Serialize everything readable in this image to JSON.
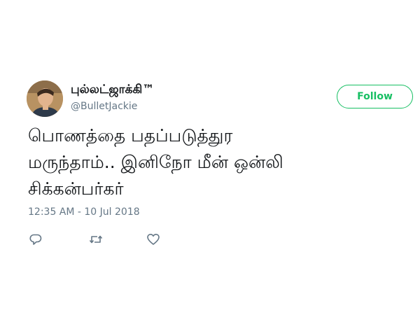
{
  "tweet": {
    "display_name": "புல்லட்ஜாக்கி™",
    "handle": "@BulletJackie",
    "follow_label": "Follow",
    "text_lines": [
      "பொணத்தை பதப்படுத்துர",
      "மருந்தாம்.. இனிநோ மீன்  ஒன்லி",
      "சிக்கன்பர்கர்"
    ],
    "timestamp": "12:35 AM - 10 Jul 2018"
  },
  "icons": {
    "reply": "reply-icon",
    "retweet": "retweet-icon",
    "like": "heart-icon"
  },
  "colors": {
    "accent_green": "#17bf63",
    "secondary_text": "#657786",
    "icon_gray": "#657786"
  }
}
